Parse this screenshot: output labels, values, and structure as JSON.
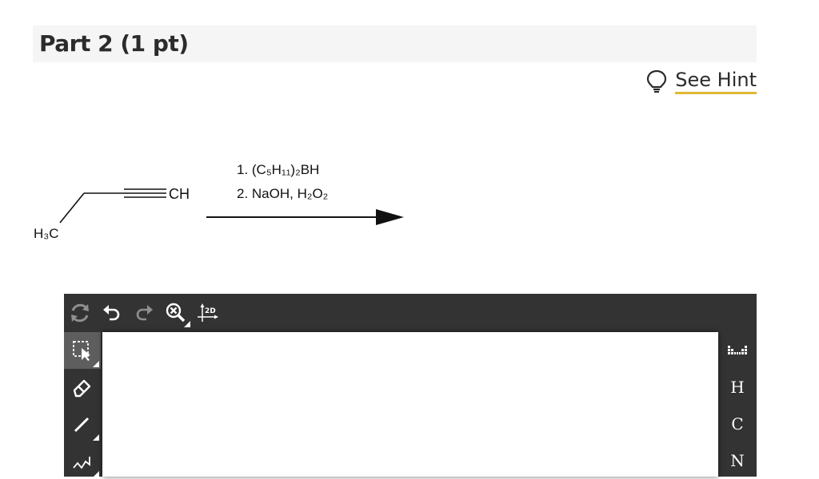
{
  "header": {
    "title": "Part 2 (1 pt)"
  },
  "hint": {
    "label": "See Hint",
    "icon": "lightbulb-icon"
  },
  "reaction": {
    "reactant_ch": "CH",
    "reactant_h3c": "H₃C",
    "step1": "1. (C₅H₁₁)₂BH",
    "step2": "2. NaOH, H₂O₂"
  },
  "sketcher": {
    "top_tools": [
      {
        "name": "refresh-icon"
      },
      {
        "name": "undo-icon"
      },
      {
        "name": "redo-icon"
      },
      {
        "name": "zoom-clear-icon"
      },
      {
        "name": "2d-clean-icon",
        "label": "2D"
      }
    ],
    "left_tools": [
      {
        "name": "lasso-select-icon"
      },
      {
        "name": "eraser-icon"
      },
      {
        "name": "single-bond-icon"
      },
      {
        "name": "chain-icon"
      }
    ],
    "right_tools": {
      "periodic_icon": "periodic-table-icon",
      "atoms": [
        "H",
        "C",
        "N"
      ]
    }
  }
}
